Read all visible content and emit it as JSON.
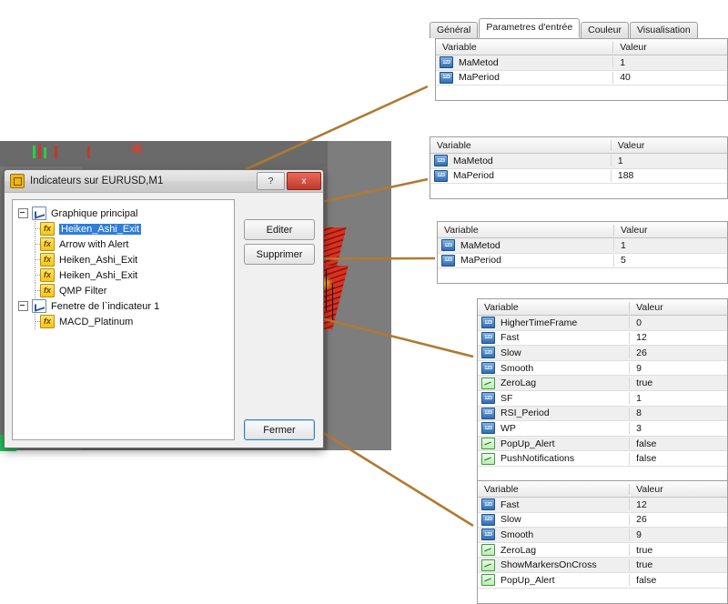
{
  "dialog": {
    "title": "Indicateurs sur EURUSD,M1",
    "help_button": "?",
    "close_button": "x",
    "buttons": {
      "edit": "Editer",
      "delete": "Supprimer",
      "close": "Fermer"
    },
    "tree": [
      {
        "label": "Graphique principal",
        "type": "group",
        "icon": "chart-icon",
        "selected": false
      },
      {
        "label": "Heiken_Ashi_Exit",
        "type": "indicator",
        "icon": "fx-icon",
        "selected": true
      },
      {
        "label": "Arrow with Alert",
        "type": "indicator",
        "icon": "fx-icon",
        "selected": false
      },
      {
        "label": "Heiken_Ashi_Exit",
        "type": "indicator",
        "icon": "fx-icon",
        "selected": false
      },
      {
        "label": "Heiken_Ashi_Exit",
        "type": "indicator",
        "icon": "fx-icon",
        "selected": false
      },
      {
        "label": "QMP Filter",
        "type": "indicator",
        "icon": "fx-icon",
        "selected": false
      },
      {
        "label": "Fenetre de l`indicateur 1",
        "type": "group",
        "icon": "chart-icon",
        "selected": false
      },
      {
        "label": "MACD_Platinum",
        "type": "indicator",
        "icon": "fx-icon",
        "selected": false
      }
    ]
  },
  "tabs": [
    {
      "label": "Général",
      "active": false
    },
    {
      "label": "Parametres d'entrée",
      "active": true
    },
    {
      "label": "Couleur",
      "active": false
    },
    {
      "label": "Visualisation",
      "active": false
    }
  ],
  "columns": {
    "variable": "Variable",
    "value": "Valeur"
  },
  "panels": [
    {
      "id": "panel-heiken-ashi-exit-1",
      "rows": [
        {
          "icon": "number-icon",
          "name": "MaMetod",
          "value": "1"
        },
        {
          "icon": "number-icon",
          "name": "MaPeriod",
          "value": "40"
        }
      ]
    },
    {
      "id": "panel-heiken-ashi-exit-2",
      "rows": [
        {
          "icon": "number-icon",
          "name": "MaMetod",
          "value": "1"
        },
        {
          "icon": "number-icon",
          "name": "MaPeriod",
          "value": "188"
        }
      ]
    },
    {
      "id": "panel-heiken-ashi-exit-3",
      "rows": [
        {
          "icon": "number-icon",
          "name": "MaMetod",
          "value": "1"
        },
        {
          "icon": "number-icon",
          "name": "MaPeriod",
          "value": "5"
        }
      ]
    },
    {
      "id": "panel-qmp-filter",
      "rows": [
        {
          "icon": "number-icon",
          "name": "HigherTimeFrame",
          "value": "0"
        },
        {
          "icon": "number-icon",
          "name": "Fast",
          "value": "12"
        },
        {
          "icon": "number-icon",
          "name": "Slow",
          "value": "26"
        },
        {
          "icon": "number-icon",
          "name": "Smooth",
          "value": "9"
        },
        {
          "icon": "bool-icon",
          "name": "ZeroLag",
          "value": "true"
        },
        {
          "icon": "number-icon",
          "name": "SF",
          "value": "1"
        },
        {
          "icon": "number-icon",
          "name": "RSI_Period",
          "value": "8"
        },
        {
          "icon": "number-icon",
          "name": "WP",
          "value": "3"
        },
        {
          "icon": "bool-icon",
          "name": "PopUp_Alert",
          "value": "false"
        },
        {
          "icon": "bool-icon",
          "name": "PushNotifications",
          "value": "false"
        }
      ]
    },
    {
      "id": "panel-macd-platinum",
      "rows": [
        {
          "icon": "number-icon",
          "name": "Fast",
          "value": "12"
        },
        {
          "icon": "number-icon",
          "name": "Slow",
          "value": "26"
        },
        {
          "icon": "number-icon",
          "name": "Smooth",
          "value": "9"
        },
        {
          "icon": "bool-icon",
          "name": "ZeroLag",
          "value": "true"
        },
        {
          "icon": "bool-icon",
          "name": "ShowMarkersOnCross",
          "value": "true"
        },
        {
          "icon": "bool-icon",
          "name": "PopUp_Alert",
          "value": "false"
        }
      ]
    }
  ],
  "colors": {
    "arrow": "#b07a32",
    "arrow_head": "#f28c28",
    "selection": "#2f7ddb",
    "close_button": "#c0392b",
    "chart_background": "#6e6e6e"
  }
}
